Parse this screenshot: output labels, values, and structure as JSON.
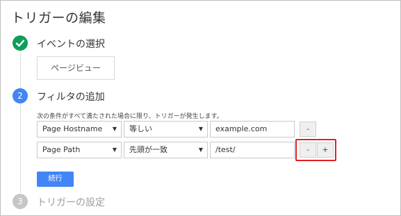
{
  "page": {
    "title": "トリガーの編集"
  },
  "steps": [
    {
      "number": "✔",
      "label": "イベントの選択",
      "state": "done"
    },
    {
      "number": "2",
      "label": "フィルタの追加",
      "state": "active"
    },
    {
      "number": "3",
      "label": "トリガーの設定",
      "state": "inactive"
    }
  ],
  "event": {
    "selected": "ページビュー"
  },
  "filter": {
    "description": "次の条件がすべて満たされた場合に限り、トリガーが発生します。",
    "rows": [
      {
        "variable": "Page Hostname",
        "operator": "等しい",
        "value": "example.com"
      },
      {
        "variable": "Page Path",
        "operator": "先頭が一致",
        "value": "/test/"
      }
    ],
    "remove_label": "-",
    "add_label": "+",
    "dropdown_arrow": "▼"
  },
  "continue_label": "続行",
  "colors": {
    "done": "#0f9d58",
    "active": "#4285f4",
    "inactive": "#c6c6c6",
    "highlight": "#e02020",
    "primary_button": "#4285f4"
  }
}
